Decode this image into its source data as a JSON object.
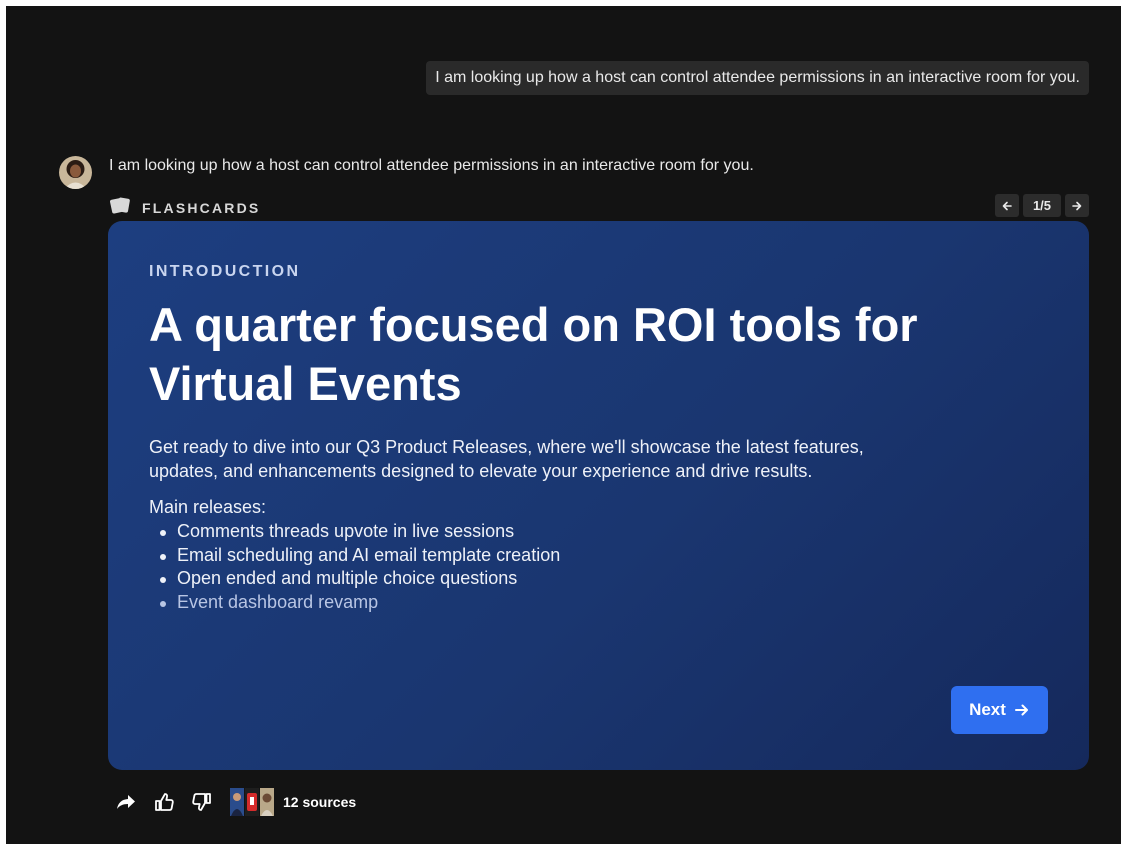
{
  "chat": {
    "user_message": "I am looking up how a host can control attendee permissions in an interactive room for you.",
    "assistant_message": "I am looking up how a host can control attendee permissions in an interactive room for you."
  },
  "flashcards": {
    "header_label": "FLASHCARDS",
    "header_icon": "cards-icon",
    "pager": {
      "prev_icon": "arrow-left-icon",
      "count": "1/5",
      "next_icon": "arrow-right-icon"
    },
    "card": {
      "eyebrow": "INTRODUCTION",
      "headline": "A quarter focused on ROI tools for Virtual Events",
      "description": "Get ready to dive into our Q3 Product Releases, where we'll showcase the latest features, updates, and enhancements designed to elevate your experience and drive results.",
      "releases_label": "Main releases:",
      "releases": [
        "Comments threads upvote in live sessions",
        "Email scheduling and AI email template creation",
        "Open ended and multiple choice questions",
        "Event dashboard revamp"
      ],
      "next_label": "Next",
      "background_color": "#1d3e80",
      "button_color": "#2f6ff0"
    }
  },
  "actions": {
    "share_icon": "share-icon",
    "like_icon": "thumbs-up-icon",
    "dislike_icon": "thumbs-down-icon",
    "sources_label": "12 sources"
  },
  "theme": {
    "background": "#131313",
    "bubble": "#2a2a2a"
  }
}
